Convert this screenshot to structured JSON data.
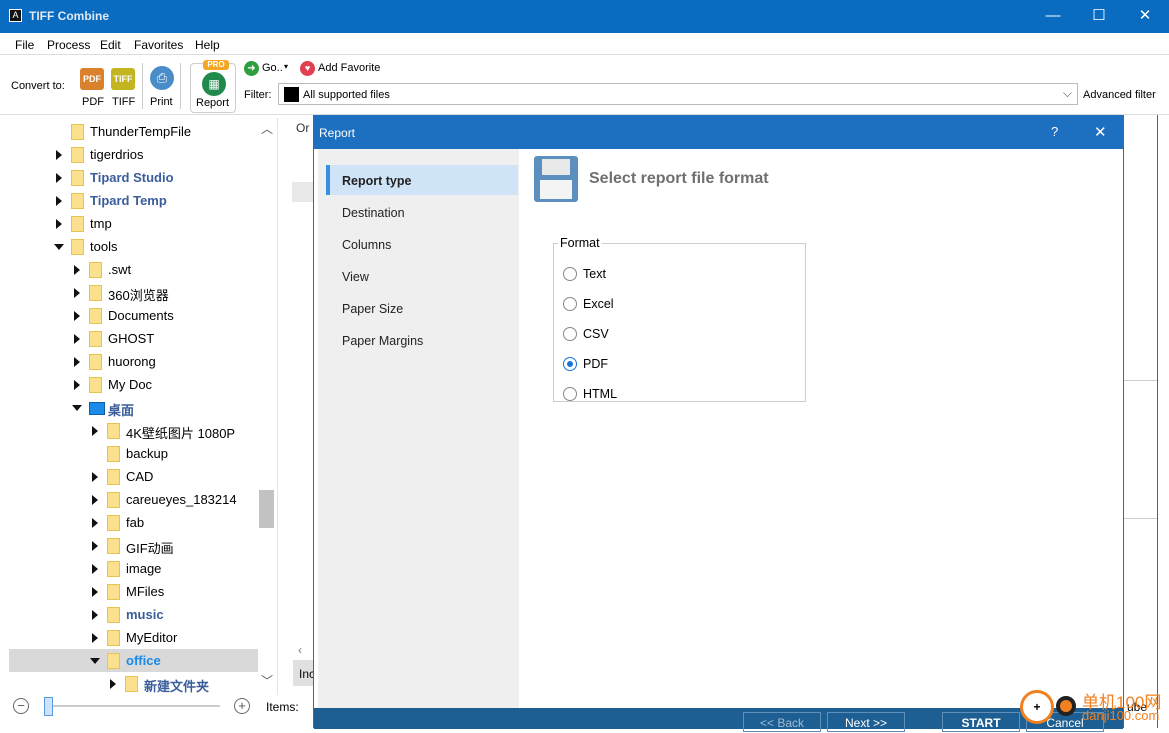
{
  "app": {
    "title": "TIFF Combine",
    "logo": "A"
  },
  "menu": [
    "File",
    "Process",
    "Edit",
    "Favorites",
    "Help"
  ],
  "toolbar": {
    "convert_to": "Convert to:",
    "pdf": "PDF",
    "tiff": "TIFF",
    "print": "Print",
    "report": "Report",
    "pro_badge": "PRO",
    "go": "Go..",
    "add_favorite": "Add Favorite",
    "filter_label": "Filter:",
    "filter_value": "All supported files",
    "advanced_filter": "Advanced filter"
  },
  "tree": [
    {
      "label": "ThunderTempFile",
      "level": 1,
      "arrow": "none"
    },
    {
      "label": "tigerdrios",
      "level": 1,
      "arrow": "c"
    },
    {
      "label": "Tipard Studio",
      "level": 1,
      "arrow": "c",
      "style": "b"
    },
    {
      "label": "Tipard Temp",
      "level": 1,
      "arrow": "c",
      "style": "b"
    },
    {
      "label": "tmp",
      "level": 1,
      "arrow": "c"
    },
    {
      "label": "tools",
      "level": 1,
      "arrow": "e"
    },
    {
      "label": ".swt",
      "level": 2,
      "arrow": "c"
    },
    {
      "label": "360浏览器",
      "level": 2,
      "arrow": "c"
    },
    {
      "label": "Documents",
      "level": 2,
      "arrow": "c"
    },
    {
      "label": "GHOST",
      "level": 2,
      "arrow": "c"
    },
    {
      "label": "huorong",
      "level": 2,
      "arrow": "c"
    },
    {
      "label": "My Doc",
      "level": 2,
      "arrow": "c"
    },
    {
      "label": "桌面",
      "level": 2,
      "arrow": "e",
      "style": "b",
      "icon": "desktop"
    },
    {
      "label": "4K壁纸图片 1080P",
      "level": 3,
      "arrow": "c"
    },
    {
      "label": "backup",
      "level": 3,
      "arrow": "none",
      "icon": "shared"
    },
    {
      "label": "CAD",
      "level": 3,
      "arrow": "c"
    },
    {
      "label": "careueyes_183214",
      "level": 3,
      "arrow": "c"
    },
    {
      "label": "fab",
      "level": 3,
      "arrow": "c"
    },
    {
      "label": "GIF动画",
      "level": 3,
      "arrow": "c"
    },
    {
      "label": "image",
      "level": 3,
      "arrow": "c"
    },
    {
      "label": "MFiles",
      "level": 3,
      "arrow": "c"
    },
    {
      "label": "music",
      "level": 3,
      "arrow": "c",
      "style": "b"
    },
    {
      "label": "MyEditor",
      "level": 3,
      "arrow": "c"
    },
    {
      "label": "office",
      "level": 3,
      "arrow": "e",
      "style": "blue",
      "selected": true
    },
    {
      "label": "新建文件夹",
      "level": 4,
      "arrow": "c",
      "style": "b"
    }
  ],
  "bottom": {
    "items_label": "Items:"
  },
  "background": {
    "col_header": "Or",
    "bottom_tab": "Inc",
    "right_text": "ube"
  },
  "dialog": {
    "title": "Report",
    "help": "?",
    "close": "✕",
    "nav": [
      "Report type",
      "Destination",
      "Columns",
      "View",
      "Paper Size",
      "Paper Margins"
    ],
    "active_nav": 0,
    "heading": "Select report file format",
    "format_legend": "Format",
    "formats": [
      "Text",
      "Excel",
      "CSV",
      "PDF",
      "HTML"
    ],
    "selected_format": "PDF",
    "buttons": {
      "back": "<< Back",
      "next": "Next >>",
      "start": "START",
      "cancel": "Cancel"
    }
  },
  "watermark": {
    "text1": "单机100网",
    "text2": "danji100.com"
  },
  "colors": {
    "titlebar": "#0a6cc0",
    "dialog_title": "#1d6fbf",
    "footer": "#1d5f93",
    "accent": "#1a73d9"
  }
}
